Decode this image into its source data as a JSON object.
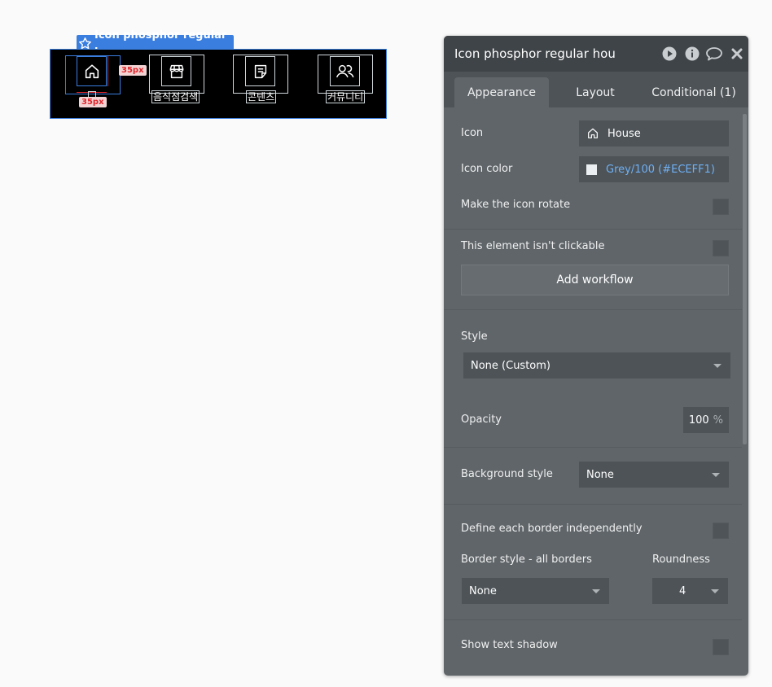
{
  "canvas": {
    "selection_label": "Icon phosphor regular h...",
    "dimension_right": "35px",
    "dimension_bottom": "35px",
    "nav_items": [
      {
        "icon": "house-icon",
        "label": ""
      },
      {
        "icon": "storefront-icon",
        "label": "음식점검색"
      },
      {
        "icon": "note-icon",
        "label": "콘텐츠"
      },
      {
        "icon": "users-icon",
        "label": "커뮤니티"
      }
    ]
  },
  "panel": {
    "title": "Icon phosphor regular hou",
    "header_icons": [
      "play-icon",
      "info-icon",
      "comment-icon",
      "close-icon"
    ],
    "tabs": [
      {
        "label": "Appearance",
        "active": true
      },
      {
        "label": "Layout",
        "active": false
      },
      {
        "label": "Conditional (1)",
        "active": false
      }
    ],
    "icon_label": "Icon",
    "icon_value": "House",
    "icon_color_label": "Icon color",
    "icon_color_value": "Grey/100 (#ECEFF1)",
    "icon_color_hex": "#ECEFF1",
    "rotate_label": "Make the icon rotate",
    "not_clickable_label": "This element isn't clickable",
    "add_workflow": "Add workflow",
    "style_label": "Style",
    "style_value": "None (Custom)",
    "opacity_label": "Opacity",
    "opacity_value": "100",
    "opacity_unit": "%",
    "background_label": "Background style",
    "background_value": "None",
    "border_independent_label": "Define each border independently",
    "border_style_label": "Border style - all borders",
    "border_style_value": "None",
    "roundness_label": "Roundness",
    "roundness_value": "4",
    "text_shadow_label": "Show text shadow"
  },
  "colors": {
    "accent": "#3a7ee0",
    "panel_bg": "#5f6569",
    "header_bg": "#3f4448",
    "link_blue": "#6fb0f5",
    "dim_red": "#e0262c"
  }
}
